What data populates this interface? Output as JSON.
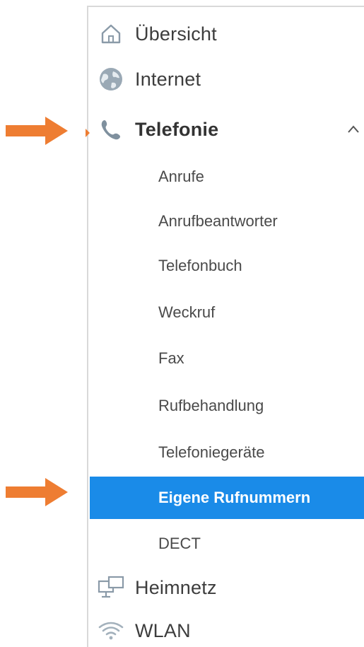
{
  "colors": {
    "accent_orange": "#ee7d32",
    "active_blue": "#1a8be8",
    "text": "#3d3d3d",
    "icon_gray": "#8a9aa8"
  },
  "nav": {
    "items": [
      {
        "label": "Übersicht",
        "icon": "home-icon"
      },
      {
        "label": "Internet",
        "icon": "globe-icon"
      },
      {
        "label": "Telefonie",
        "icon": "phone-icon",
        "expanded": true
      },
      {
        "label": "Heimnetz",
        "icon": "network-icon"
      },
      {
        "label": "WLAN",
        "icon": "wifi-icon"
      }
    ],
    "telefonie_sub": [
      {
        "label": "Anrufe"
      },
      {
        "label": "Anrufbeantworter"
      },
      {
        "label": "Telefonbuch"
      },
      {
        "label": "Weckruf"
      },
      {
        "label": "Fax"
      },
      {
        "label": "Rufbehandlung"
      },
      {
        "label": "Telefoniegeräte"
      },
      {
        "label": "Eigene Rufnummern",
        "active": true
      },
      {
        "label": "DECT"
      }
    ]
  }
}
